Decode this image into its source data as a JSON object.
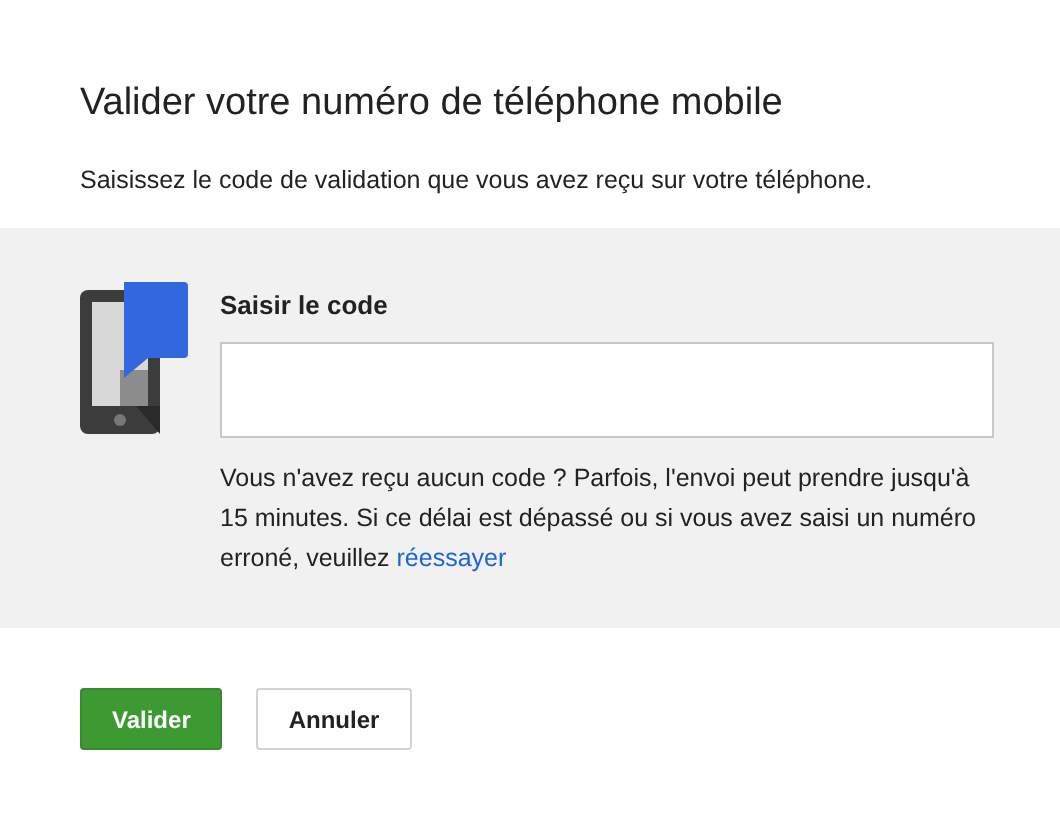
{
  "dialog": {
    "title": "Valider votre numéro de téléphone mobile",
    "subtitle": "Saisissez le code de validation que vous avez reçu sur votre téléphone."
  },
  "code_field": {
    "label": "Saisir le code"
  },
  "help": {
    "text": "Vous n'avez reçu aucun code ? Parfois, l'envoi peut prendre jusqu'à 15 minutes. Si ce délai est dépassé ou si vous avez saisi un numéro erroné, veuillez",
    "link": "réessayer"
  },
  "buttons": [
    {
      "label": "Valider",
      "kind": "primary"
    },
    {
      "label": "Annuler",
      "kind": "secondary"
    }
  ]
}
